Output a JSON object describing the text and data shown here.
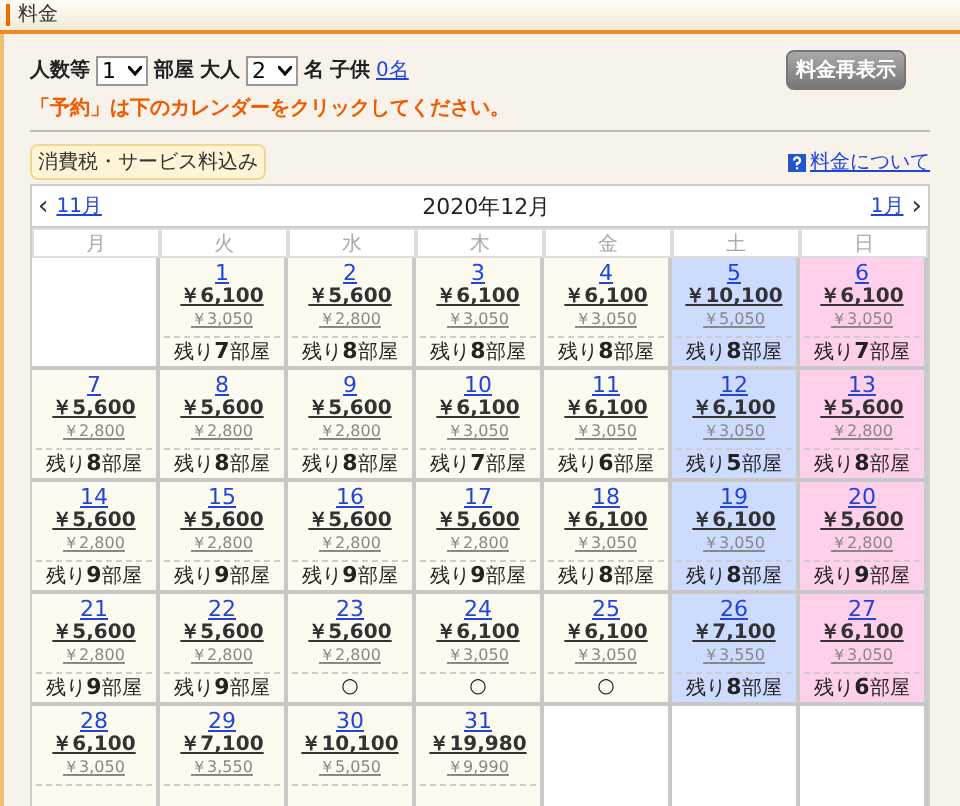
{
  "header": {
    "title": "料金"
  },
  "form": {
    "rooms_label": "人数等",
    "rooms": "1",
    "room_unit": "部屋",
    "adults_label": "大人",
    "adults": "2",
    "adult_unit": "名",
    "children_label": "子供",
    "children_link": "0名",
    "refresh_button": "料金再表示"
  },
  "notice": "「予約」は下のカレンダーをクリックしてください。",
  "tax_badge": "消費税・サービス料込み",
  "help_link": "料金について",
  "calendar": {
    "prev": "11月",
    "title": "2020年12月",
    "next": "1月",
    "prev_arrow": "‹",
    "next_arrow": "›",
    "weekdays": [
      "月",
      "火",
      "水",
      "木",
      "金",
      "土",
      "日"
    ],
    "weeks": [
      [
        {
          "kind": "empty"
        },
        {
          "kind": "weekday",
          "day": "1",
          "price": "￥6,100",
          "sub": "￥3,050",
          "avail": "残り**7**部屋"
        },
        {
          "kind": "weekday",
          "day": "2",
          "price": "￥5,600",
          "sub": "￥2,800",
          "avail": "残り**8**部屋"
        },
        {
          "kind": "weekday",
          "day": "3",
          "price": "￥6,100",
          "sub": "￥3,050",
          "avail": "残り**8**部屋"
        },
        {
          "kind": "weekday",
          "day": "4",
          "price": "￥6,100",
          "sub": "￥3,050",
          "avail": "残り**8**部屋"
        },
        {
          "kind": "saturday",
          "day": "5",
          "price": "￥10,100",
          "sub": "￥5,050",
          "avail": "残り**8**部屋"
        },
        {
          "kind": "sunday",
          "day": "6",
          "price": "￥6,100",
          "sub": "￥3,050",
          "avail": "残り**7**部屋"
        }
      ],
      [
        {
          "kind": "weekday",
          "day": "7",
          "price": "￥5,600",
          "sub": "￥2,800",
          "avail": "残り**8**部屋"
        },
        {
          "kind": "weekday",
          "day": "8",
          "price": "￥5,600",
          "sub": "￥2,800",
          "avail": "残り**8**部屋"
        },
        {
          "kind": "weekday",
          "day": "9",
          "price": "￥5,600",
          "sub": "￥2,800",
          "avail": "残り**8**部屋"
        },
        {
          "kind": "weekday",
          "day": "10",
          "price": "￥6,100",
          "sub": "￥3,050",
          "avail": "残り**7**部屋"
        },
        {
          "kind": "weekday",
          "day": "11",
          "price": "￥6,100",
          "sub": "￥3,050",
          "avail": "残り**6**部屋"
        },
        {
          "kind": "saturday",
          "day": "12",
          "price": "￥6,100",
          "sub": "￥3,050",
          "avail": "残り**5**部屋"
        },
        {
          "kind": "sunday",
          "day": "13",
          "price": "￥5,600",
          "sub": "￥2,800",
          "avail": "残り**8**部屋"
        }
      ],
      [
        {
          "kind": "weekday",
          "day": "14",
          "price": "￥5,600",
          "sub": "￥2,800",
          "avail": "残り**9**部屋"
        },
        {
          "kind": "weekday",
          "day": "15",
          "price": "￥5,600",
          "sub": "￥2,800",
          "avail": "残り**9**部屋"
        },
        {
          "kind": "weekday",
          "day": "16",
          "price": "￥5,600",
          "sub": "￥2,800",
          "avail": "残り**9**部屋"
        },
        {
          "kind": "weekday",
          "day": "17",
          "price": "￥5,600",
          "sub": "￥2,800",
          "avail": "残り**9**部屋"
        },
        {
          "kind": "weekday",
          "day": "18",
          "price": "￥6,100",
          "sub": "￥3,050",
          "avail": "残り**8**部屋"
        },
        {
          "kind": "saturday",
          "day": "19",
          "price": "￥6,100",
          "sub": "￥3,050",
          "avail": "残り**8**部屋"
        },
        {
          "kind": "sunday",
          "day": "20",
          "price": "￥5,600",
          "sub": "￥2,800",
          "avail": "残り**9**部屋"
        }
      ],
      [
        {
          "kind": "weekday",
          "day": "21",
          "price": "￥5,600",
          "sub": "￥2,800",
          "avail": "残り**9**部屋"
        },
        {
          "kind": "weekday",
          "day": "22",
          "price": "￥5,600",
          "sub": "￥2,800",
          "avail": "残り**9**部屋"
        },
        {
          "kind": "weekday",
          "day": "23",
          "price": "￥5,600",
          "sub": "￥2,800",
          "avail": "○"
        },
        {
          "kind": "weekday",
          "day": "24",
          "price": "￥6,100",
          "sub": "￥3,050",
          "avail": "○"
        },
        {
          "kind": "weekday",
          "day": "25",
          "price": "￥6,100",
          "sub": "￥3,050",
          "avail": "○"
        },
        {
          "kind": "saturday",
          "day": "26",
          "price": "￥7,100",
          "sub": "￥3,550",
          "avail": "残り**8**部屋"
        },
        {
          "kind": "sunday",
          "day": "27",
          "price": "￥6,100",
          "sub": "￥3,050",
          "avail": "残り**6**部屋"
        }
      ],
      [
        {
          "kind": "weekday",
          "day": "28",
          "price": "￥6,100",
          "sub": "￥3,050"
        },
        {
          "kind": "weekday",
          "day": "29",
          "price": "￥7,100",
          "sub": "￥3,550"
        },
        {
          "kind": "weekday",
          "day": "30",
          "price": "￥10,100",
          "sub": "￥5,050"
        },
        {
          "kind": "weekday",
          "day": "31",
          "price": "￥19,980",
          "sub": "￥9,990"
        },
        {
          "kind": "empty"
        },
        {
          "kind": "empty"
        },
        {
          "kind": "empty"
        }
      ]
    ]
  }
}
